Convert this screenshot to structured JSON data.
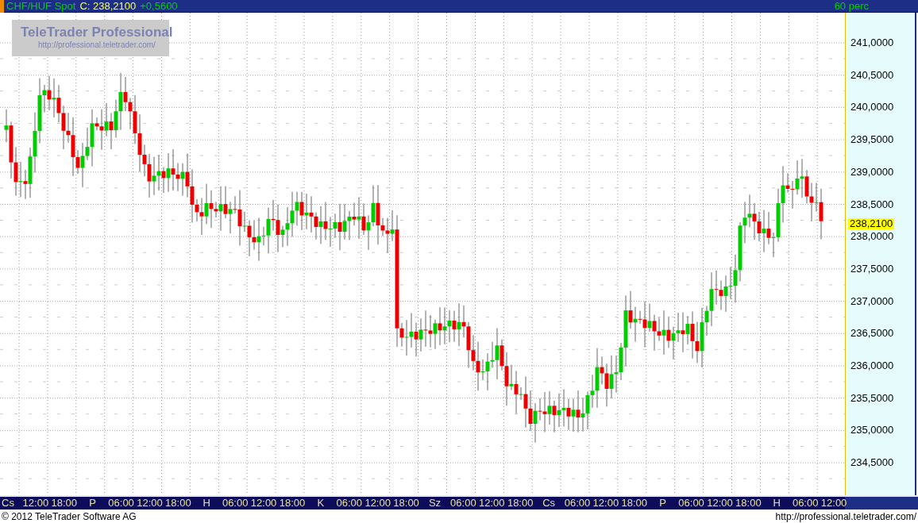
{
  "header": {
    "symbol": "CHF/HUF Spot",
    "close": "C: 238,2100",
    "change": "+0,5600",
    "period": "60 perc"
  },
  "watermark": {
    "title": "TeleTrader Professional",
    "url": "http://professional.teletrader.com/"
  },
  "price_axis": {
    "ticks": [
      "241,0000",
      "240,5000",
      "240,0000",
      "239,5000",
      "239,0000",
      "238,5000",
      "238,0000",
      "237,5000",
      "237,0000",
      "236,5000",
      "236,0000",
      "235,5000",
      "235,0000",
      "234,5000"
    ],
    "current": "238,2100"
  },
  "time_axis": {
    "labels": [
      "Cs",
      "12:00",
      "18:00",
      "P",
      "06:00",
      "12:00",
      "18:00",
      "H",
      "06:00",
      "12:00",
      "18:00",
      "K",
      "06:00",
      "12:00",
      "18:00",
      "Sz",
      "06:00",
      "12:00",
      "18:00",
      "Cs",
      "06:00",
      "12:00",
      "18:00",
      "P",
      "06:00",
      "12:00",
      "18:00",
      "H",
      "06:00",
      "12:00"
    ]
  },
  "footer": {
    "copyright": "© 2012 TeleTrader Software AG",
    "url": "http://professional.teletrader.com/"
  }
}
